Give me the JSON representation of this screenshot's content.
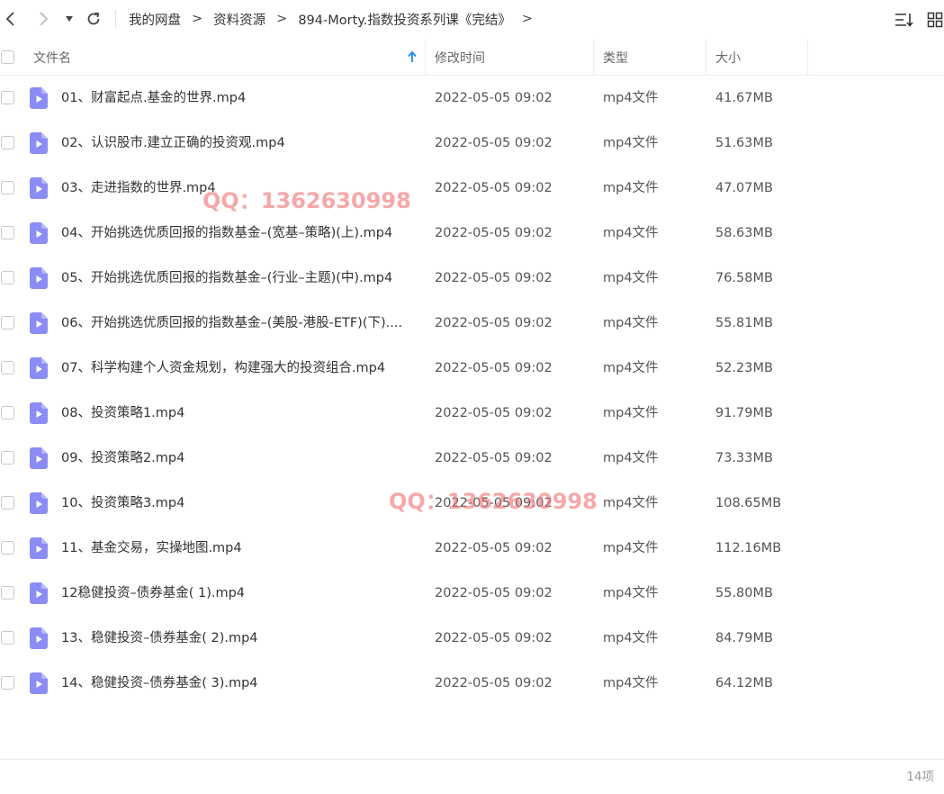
{
  "breadcrumb": [
    "我的网盘",
    "资料资源",
    "894-Morty.指数投资系列课《完结》"
  ],
  "breadcrumb_sep": ">",
  "columns": {
    "name": "文件名",
    "modified": "修改时间",
    "type": "类型",
    "size": "大小"
  },
  "files": [
    {
      "name": "01、财富起点.基金的世界.mp4",
      "modified": "2022-05-05 09:02",
      "type": "mp4文件",
      "size": "41.67MB"
    },
    {
      "name": "02、认识股市.建立正确的投资观.mp4",
      "modified": "2022-05-05 09:02",
      "type": "mp4文件",
      "size": "51.63MB"
    },
    {
      "name": "03、走进指数的世界.mp4",
      "modified": "2022-05-05 09:02",
      "type": "mp4文件",
      "size": "47.07MB"
    },
    {
      "name": "04、开始挑选优质回报的指数基金–(宽基–策略)(上).mp4",
      "modified": "2022-05-05 09:02",
      "type": "mp4文件",
      "size": "58.63MB"
    },
    {
      "name": "05、开始挑选优质回报的指数基金–(行业–主题)(中).mp4",
      "modified": "2022-05-05 09:02",
      "type": "mp4文件",
      "size": "76.58MB"
    },
    {
      "name": "06、开始挑选优质回报的指数基金–(美股-港股-ETF)(下)....",
      "modified": "2022-05-05 09:02",
      "type": "mp4文件",
      "size": "55.81MB"
    },
    {
      "name": "07、科学构建个人资金规划，构建强大的投资组合.mp4",
      "modified": "2022-05-05 09:02",
      "type": "mp4文件",
      "size": "52.23MB"
    },
    {
      "name": "08、投资策略1.mp4",
      "modified": "2022-05-05 09:02",
      "type": "mp4文件",
      "size": "91.79MB"
    },
    {
      "name": "09、投资策略2.mp4",
      "modified": "2022-05-05 09:02",
      "type": "mp4文件",
      "size": "73.33MB"
    },
    {
      "name": "10、投资策略3.mp4",
      "modified": "2022-05-05 09:02",
      "type": "mp4文件",
      "size": "108.65MB"
    },
    {
      "name": "11、基金交易，实操地图.mp4",
      "modified": "2022-05-05 09:02",
      "type": "mp4文件",
      "size": "112.16MB"
    },
    {
      "name": "12稳健投资–债券基金( 1).mp4",
      "modified": "2022-05-05 09:02",
      "type": "mp4文件",
      "size": "55.80MB"
    },
    {
      "name": "13、稳健投资–债券基金( 2).mp4",
      "modified": "2022-05-05 09:02",
      "type": "mp4文件",
      "size": "84.79MB"
    },
    {
      "name": "14、稳健投资–债券基金( 3).mp4",
      "modified": "2022-05-05 09:02",
      "type": "mp4文件",
      "size": "64.12MB"
    }
  ],
  "watermarks": [
    "QQ：1362630998",
    "QQ：1362630998"
  ],
  "footer": {
    "count": "14项"
  },
  "icons": {
    "back": "chevron-left-icon",
    "forward": "chevron-right-icon",
    "history": "caret-down-icon",
    "refresh": "refresh-icon",
    "sort": "sort-list-icon",
    "view": "grid-view-icon",
    "file": "video-file-icon",
    "sort_indicator": "arrow-up-icon"
  },
  "colors": {
    "accent": "#1a8cff",
    "file_icon": "#8b8cf5",
    "watermark": "#f06e6e"
  }
}
